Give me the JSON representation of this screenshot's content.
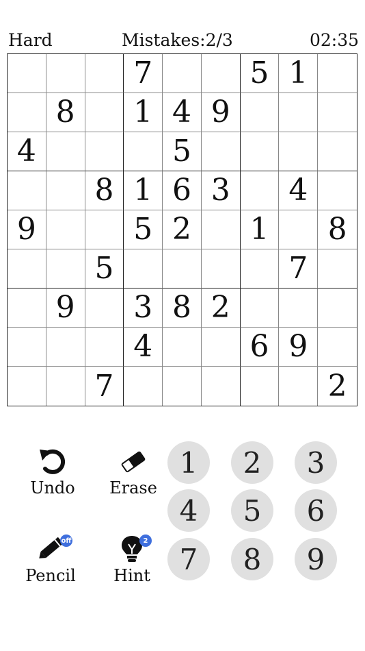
{
  "header": {
    "difficulty": "Hard",
    "mistakes": "Mistakes:2/3",
    "timer": "02:35"
  },
  "board": [
    [
      "",
      "",
      "",
      "7",
      "",
      "",
      "5",
      "1",
      ""
    ],
    [
      "",
      "8",
      "",
      "1",
      "4",
      "9",
      "",
      "",
      ""
    ],
    [
      "4",
      "",
      "",
      "",
      "5",
      "",
      "",
      "",
      ""
    ],
    [
      "",
      "",
      "8",
      "1",
      "6",
      "3",
      "",
      "4",
      ""
    ],
    [
      "9",
      "",
      "",
      "5",
      "2",
      "",
      "1",
      "",
      "8"
    ],
    [
      "",
      "",
      "5",
      "",
      "",
      "",
      "",
      "7",
      ""
    ],
    [
      "",
      "9",
      "",
      "3",
      "8",
      "2",
      "",
      "",
      ""
    ],
    [
      "",
      "",
      "",
      "4",
      "",
      "",
      "6",
      "9",
      ""
    ],
    [
      "",
      "",
      "7",
      "",
      "",
      "",
      "",
      "",
      "2"
    ]
  ],
  "tools": {
    "undo": {
      "label": "Undo",
      "icon": "undo-arrow-icon"
    },
    "erase": {
      "label": "Erase",
      "icon": "eraser-icon"
    },
    "pencil": {
      "label": "Pencil",
      "icon": "pencil-icon",
      "badge": "off"
    },
    "hint": {
      "label": "Hint",
      "icon": "lightbulb-icon",
      "badge": "2"
    }
  },
  "numpad": [
    "1",
    "2",
    "3",
    "4",
    "5",
    "6",
    "7",
    "8",
    "9"
  ],
  "colors": {
    "badge": "#3f6fdd",
    "key_bg": "#e0e0e0"
  }
}
